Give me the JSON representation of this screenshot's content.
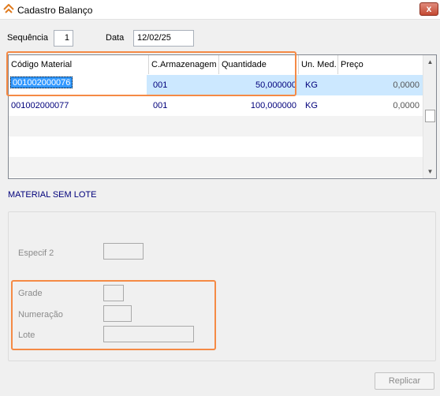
{
  "window": {
    "title": "Cadastro Balanço",
    "close_glyph": "x",
    "icon": "app-logo-icon"
  },
  "header": {
    "sequencia_label": "Sequência",
    "sequencia_value": "1",
    "data_label": "Data",
    "data_value": "12/02/25"
  },
  "grid": {
    "columns": [
      "Código Material",
      "C.Armazenagem",
      "Quantidade",
      "Un. Med.",
      "Preço"
    ],
    "rows": [
      {
        "codigo": "001002000076",
        "armazenagem": "001",
        "quantidade": "50,000000",
        "unidade": "KG",
        "preco": "0,0000"
      },
      {
        "codigo": "001002000077",
        "armazenagem": "001",
        "quantidade": "100,000000",
        "unidade": "KG",
        "preco": "0,0000"
      }
    ],
    "scroll_up_glyph": "▲",
    "scroll_down_glyph": "▼"
  },
  "section": {
    "title": "MATERIAL SEM LOTE"
  },
  "panel": {
    "especif2_label": "Especif 2",
    "grade_label": "Grade",
    "numeracao_label": "Numeração",
    "lote_label": "Lote"
  },
  "actions": {
    "replicar_label": "Replicar"
  },
  "colors": {
    "accent_highlight": "#f58a45",
    "selection": "#cce8ff",
    "focus": "#3399ff",
    "data_text": "#00007b"
  }
}
